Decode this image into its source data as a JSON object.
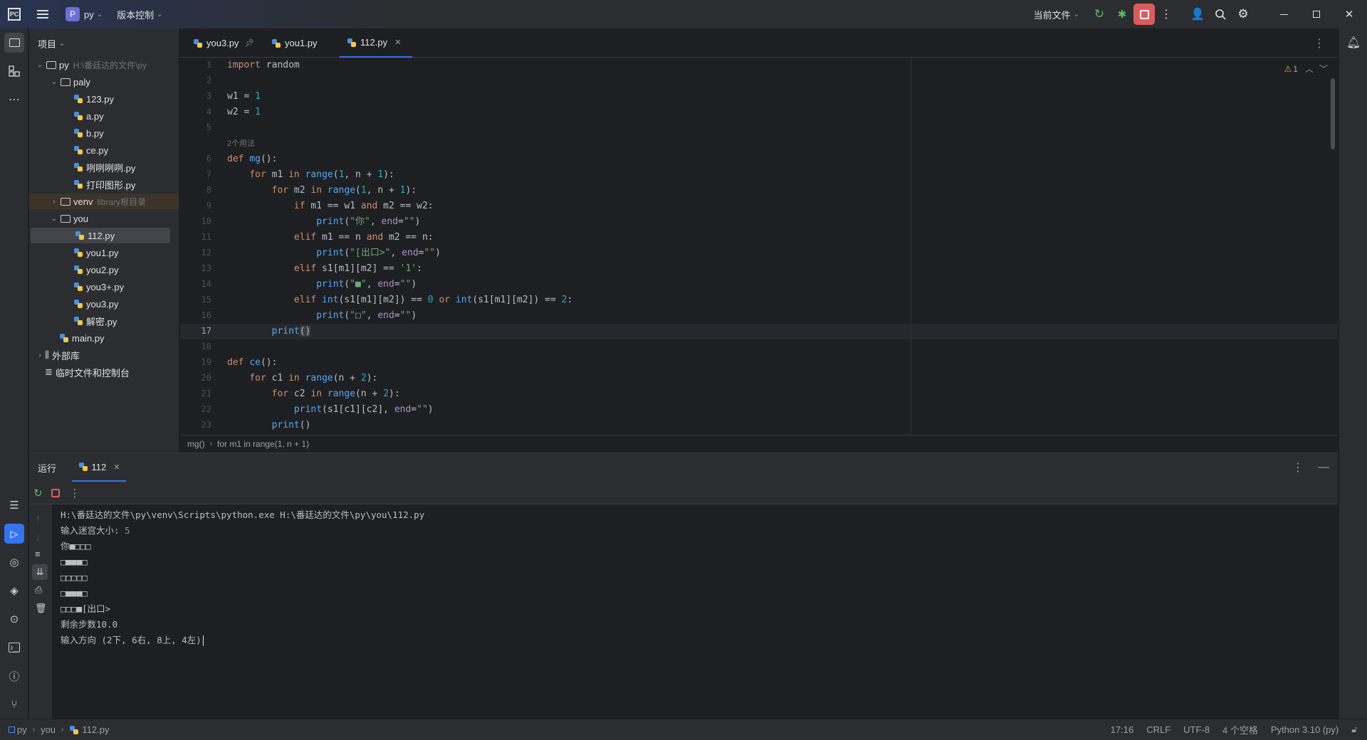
{
  "titlebar": {
    "project_badge": "P",
    "project_name": "py",
    "vcs_menu": "版本控制",
    "run_config": "当前文件"
  },
  "project_panel": {
    "title": "项目",
    "tree": [
      {
        "label": "py",
        "hint": "H:\\番廷达的文件\\py",
        "type": "folder",
        "level": 0,
        "expanded": true
      },
      {
        "label": "paly",
        "type": "folder",
        "level": 1,
        "expanded": true
      },
      {
        "label": "123.py",
        "type": "py",
        "level": 2
      },
      {
        "label": "a.py",
        "type": "py",
        "level": 2
      },
      {
        "label": "b.py",
        "type": "py",
        "level": 2
      },
      {
        "label": "ce.py",
        "type": "py",
        "level": 2
      },
      {
        "label": "咧咧咧咧.py",
        "type": "py",
        "level": 2
      },
      {
        "label": "打印图形.py",
        "type": "py",
        "level": 2
      },
      {
        "label": "venv",
        "hint": "library根目录",
        "type": "folder",
        "level": 1,
        "expanded": false
      },
      {
        "label": "you",
        "type": "folder",
        "level": 1,
        "expanded": true
      },
      {
        "label": "112.py",
        "type": "py",
        "level": 2,
        "selected": true
      },
      {
        "label": "you1.py",
        "type": "py",
        "level": 2
      },
      {
        "label": "you2.py",
        "type": "py",
        "level": 2
      },
      {
        "label": "you3+.py",
        "type": "py",
        "level": 2
      },
      {
        "label": "you3.py",
        "type": "py",
        "level": 2
      },
      {
        "label": "解密.py",
        "type": "py",
        "level": 2
      },
      {
        "label": "main.py",
        "type": "py",
        "level": 1
      },
      {
        "label": "外部库",
        "type": "lib",
        "level": 0,
        "expanded": false
      },
      {
        "label": "临时文件和控制台",
        "type": "scratch",
        "level": 0
      }
    ]
  },
  "editor": {
    "tabs": [
      {
        "label": "you3.py",
        "pinned": true
      },
      {
        "label": "you1.py"
      },
      {
        "label": "112.py",
        "active": true
      }
    ],
    "warnings_count": "1",
    "usage_hint": "2个用法",
    "line_numbers": [
      "1",
      "2",
      "3",
      "4",
      "5",
      "6",
      "7",
      "8",
      "9",
      "10",
      "11",
      "12",
      "13",
      "14",
      "15",
      "16",
      "17",
      "18",
      "19",
      "20",
      "21",
      "22",
      "23"
    ],
    "current_line": "17",
    "breadcrumb": [
      "mg()",
      "for m1 in range(1, n + 1)"
    ]
  },
  "run_panel": {
    "title": "运行",
    "tab": "112",
    "console_lines": [
      "H:\\番廷达的文件\\py\\venv\\Scripts\\python.exe H:\\番廷达的文件\\py\\you\\112.py",
      "输入迷宫大小: 5",
      "你■□□□",
      "□■■■□",
      "□□□□□",
      "□■■■□",
      "□□□■[出口>",
      "剩余步数10.0",
      "输入方向 (2下, 6右, 8上, 4左)"
    ],
    "input_value": "5"
  },
  "statusbar": {
    "path": [
      "py",
      "you",
      "112.py"
    ],
    "position": "17:16",
    "line_sep": "CRLF",
    "encoding": "UTF-8",
    "indent": "4 个空格",
    "interpreter": "Python 3.10 (py)"
  },
  "colors": {
    "accent": "#3574f0",
    "stop": "#db5c5c",
    "run": "#5fb865"
  }
}
